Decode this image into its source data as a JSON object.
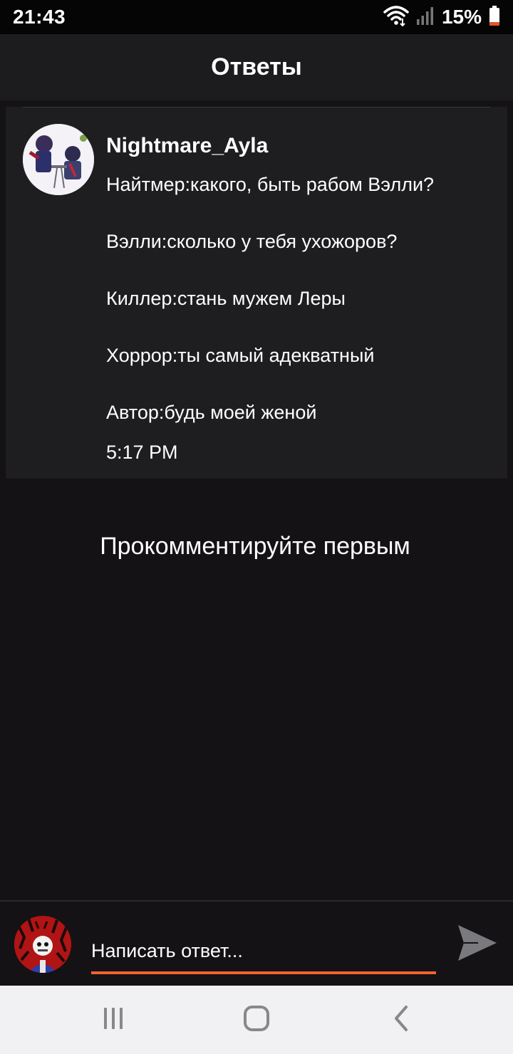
{
  "status_bar": {
    "time": "21:43",
    "battery": "15%",
    "icons": [
      "wifi-icon",
      "signal-icon",
      "battery-icon"
    ],
    "battery_accent": "#e4562b"
  },
  "header": {
    "title": "Ответы"
  },
  "post": {
    "author": "Nightmare_Ayla",
    "lines": [
      "Найтмер:какого, быть рабом Вэлли?",
      "Вэлли:сколько у тебя ухожоров?",
      "Киллер:стань мужем Леры",
      "Хоррор:ты самый адекватный",
      "Автор:будь моей женой"
    ],
    "time": "5:17 PM",
    "avatar_icon": "user-avatar-image"
  },
  "empty_state": {
    "text": "Прокомментируйте первым"
  },
  "reply": {
    "placeholder": "Написать ответ...",
    "accent": "#f2622e",
    "avatar_icon": "current-user-avatar-image",
    "send_icon": "send-icon"
  },
  "nav": {
    "icons": [
      "recent-apps-icon",
      "home-icon",
      "back-icon"
    ]
  },
  "colors": {
    "background": "#141215",
    "card": "#1e1d20",
    "header": "#1c1b1e",
    "nav": "#f1f1f3"
  }
}
